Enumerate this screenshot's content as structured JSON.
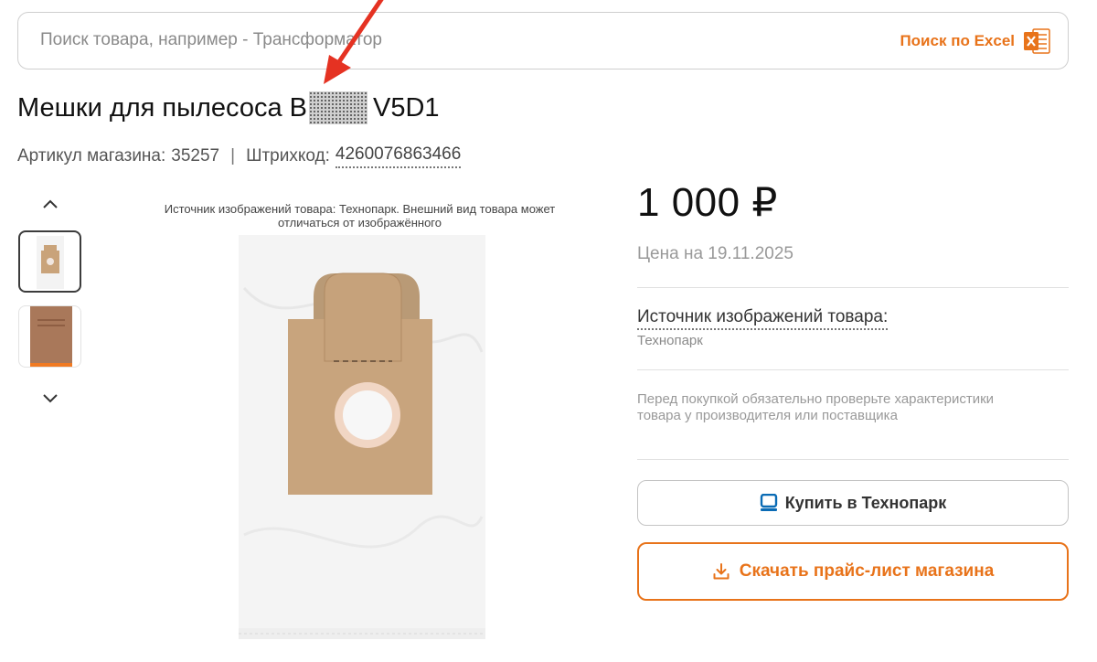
{
  "search": {
    "placeholder": "Поиск товара, например - Трансформатор",
    "excel_label": "Поиск по Excel",
    "excel_icon": "excel-file-icon"
  },
  "product": {
    "title_prefix": "Мешки для пылесоса В",
    "title_suffix": "V5D1",
    "sku_label": "Артикул магазина:",
    "sku_value": "35257",
    "barcode_label": "Штрихкод:",
    "barcode_value": "4260076863466"
  },
  "gallery": {
    "image_source_note": "Источник изображений товара: Технопарк. Внешний вид товара может отличаться от изображённого",
    "thumbnails": [
      {
        "name": "thumbnail-front",
        "selected": true
      },
      {
        "name": "thumbnail-package",
        "selected": false
      }
    ]
  },
  "pricing": {
    "price": "1 000 ₽",
    "price_date": "Цена на 19.11.2025",
    "source_label": "Источник изображений товара:",
    "source_value": "Технопарк",
    "warning": "Перед покупкой обязательно проверьте характеристики товара у производителя или поставщика"
  },
  "actions": {
    "buy_label": "Купить в Технопарк",
    "download_label": "Скачать прайс-лист магазина"
  },
  "colors": {
    "accent": "#e8731a",
    "buy_icon": "#0a6bb5",
    "text": "#1a1a1a",
    "muted": "#999999",
    "annotation_arrow": "#e53222"
  }
}
